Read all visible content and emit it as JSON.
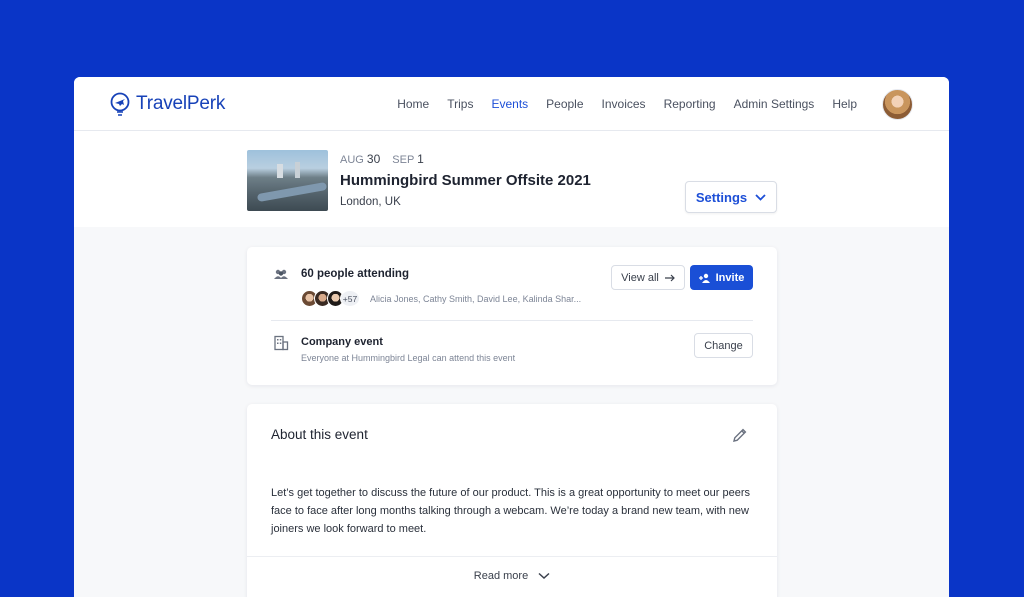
{
  "app": {
    "brand": "TravelPerk",
    "brand_color": "#1742b8",
    "accent": "#1d4fd7",
    "page_bg": "#0a35c7"
  },
  "nav": {
    "items": [
      {
        "label": "Home",
        "active": false
      },
      {
        "label": "Trips",
        "active": false
      },
      {
        "label": "Events",
        "active": true
      },
      {
        "label": "People",
        "active": false
      },
      {
        "label": "Invoices",
        "active": false
      },
      {
        "label": "Reporting",
        "active": false
      },
      {
        "label": "Admin Settings",
        "active": false
      },
      {
        "label": "Help",
        "active": false
      }
    ]
  },
  "event": {
    "start_month": "AUG",
    "start_day": "30",
    "end_month": "SEP",
    "end_day": "1",
    "title": "Hummingbird Summer Offsite 2021",
    "location": "London, UK",
    "settings_label": "Settings"
  },
  "attendance": {
    "title": "60 people attending",
    "more_count": "+57",
    "names": "Alicia Jones, Cathy Smith, David Lee, Kalinda Shar...",
    "view_all_label": "View all",
    "invite_label": "Invite"
  },
  "company": {
    "title": "Company event",
    "subtitle": "Everyone at Hummingbird Legal can attend this event",
    "change_label": "Change"
  },
  "about": {
    "title": "About this event",
    "text": "Let’s get together to discuss the future of our product. This is a great opportunity to meet our peers face to face after long months talking through a webcam. We’re today a brand new team, with new joiners we look forward to meet.",
    "read_more_label": "Read more"
  },
  "icons": [
    "plane-logo-icon",
    "people-icon",
    "building-icon",
    "arrow-right-icon",
    "add-user-icon",
    "pencil-icon",
    "chevron-down-icon"
  ]
}
